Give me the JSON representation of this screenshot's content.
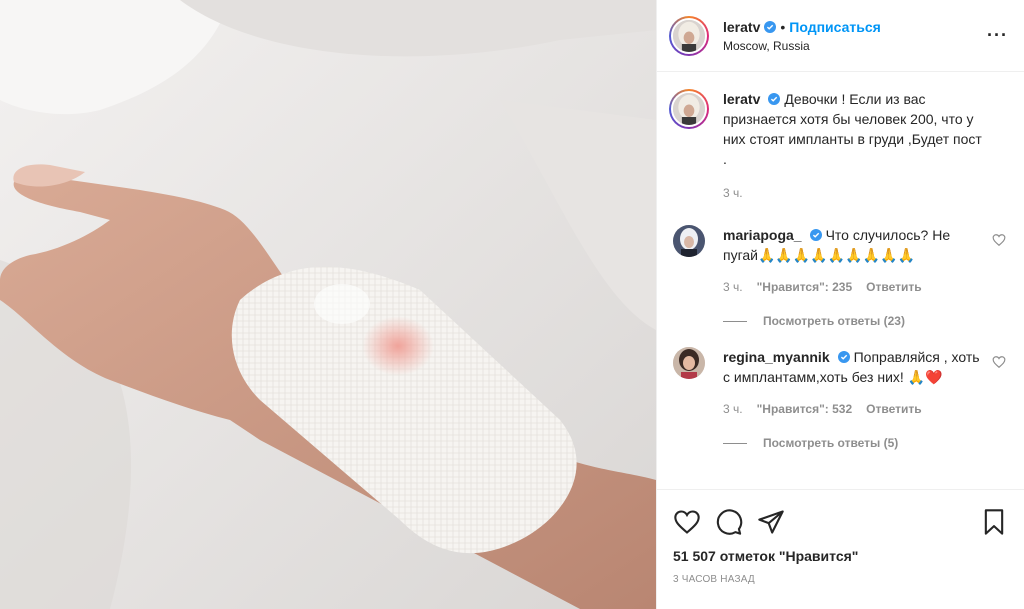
{
  "post": {
    "username": "leratv",
    "follow_label": "Подписаться",
    "dot": "•",
    "location": "Moscow, Russia",
    "more_label": "···"
  },
  "caption": {
    "username": "leratv",
    "text": "Девочки ! Если из вас признается хотя бы человек 200, что у них стоят импланты в груди ,Будет пост .",
    "time": "3 ч."
  },
  "comments": [
    {
      "username": "mariapoga_",
      "text": "Что случилось? Не пугай🙏🙏🙏🙏🙏🙏🙏🙏🙏",
      "time": "3 ч.",
      "likes": "\"Нравится\": 235",
      "reply": "Ответить",
      "replies": "Посмотреть ответы (23)"
    },
    {
      "username": "regina_myannik",
      "text": "Поправляйся , хоть с имплантамм,хоть без них! 🙏❤️",
      "time": "3 ч.",
      "likes": "\"Нравится\": 532",
      "reply": "Ответить",
      "replies": "Посмотреть ответы (5)"
    }
  ],
  "footer": {
    "likes": "51 507 отметок \"Нравится\"",
    "time": "3 часов назад"
  },
  "colors": {
    "accent": "#0095f6",
    "verified": "#3897f0",
    "muted": "#8e8e8e",
    "text": "#262626"
  },
  "icons": {
    "like": "heart-icon",
    "comment": "comment-icon",
    "share": "paper-plane-icon",
    "save": "bookmark-icon",
    "verified": "verified-badge-icon",
    "more": "more-options-icon"
  }
}
